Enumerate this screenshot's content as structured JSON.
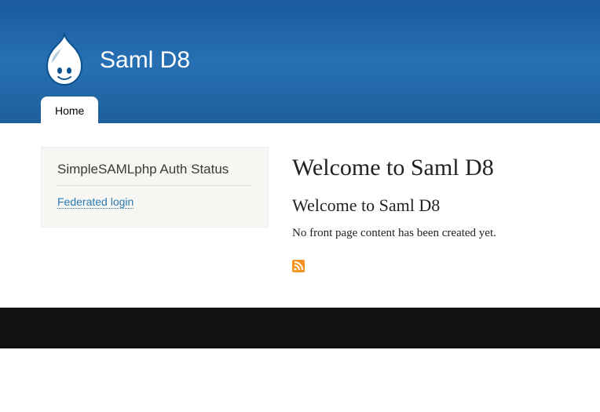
{
  "site": {
    "name": "Saml D8"
  },
  "nav": {
    "tabs": [
      {
        "label": "Home"
      }
    ]
  },
  "sidebar": {
    "block": {
      "title": "SimpleSAMLphp Auth Status",
      "link_label": "Federated login"
    }
  },
  "main": {
    "page_title": "Welcome to Saml D8",
    "subtitle": "Welcome to Saml D8",
    "body": "No front page content has been created yet."
  },
  "icons": {
    "logo": "drupal-logo",
    "rss": "rss-icon"
  }
}
